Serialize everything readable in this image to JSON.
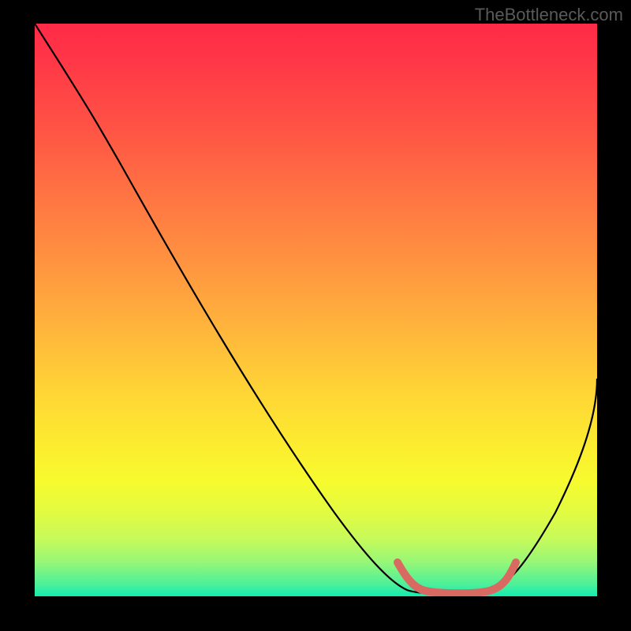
{
  "watermark": "TheBottleneck.com",
  "chart_data": {
    "type": "line",
    "title": "",
    "xlabel": "",
    "ylabel": "",
    "xlim": [
      0,
      100
    ],
    "ylim": [
      0,
      100
    ],
    "series": [
      {
        "name": "bottleneck-curve",
        "x": [
          0,
          5,
          10,
          20,
          30,
          40,
          50,
          60,
          65,
          70,
          75,
          80,
          85,
          100
        ],
        "y": [
          100,
          92,
          86,
          73,
          60,
          47,
          33,
          17,
          7,
          0,
          0,
          0,
          7,
          38
        ],
        "color": "#000000"
      },
      {
        "name": "optimal-zone",
        "x": [
          64,
          67,
          70,
          75,
          80,
          83,
          85.5
        ],
        "y": [
          6,
          1.5,
          0.5,
          0.5,
          0.5,
          2,
          6
        ],
        "color": "#d96a62",
        "stroke_width": 8
      }
    ],
    "gradient_stops": [
      {
        "pos": 0,
        "color": "#ff2a47"
      },
      {
        "pos": 50,
        "color": "#ffaa3e"
      },
      {
        "pos": 80,
        "color": "#f6fb2e"
      },
      {
        "pos": 100,
        "color": "#13ebb0"
      }
    ]
  }
}
